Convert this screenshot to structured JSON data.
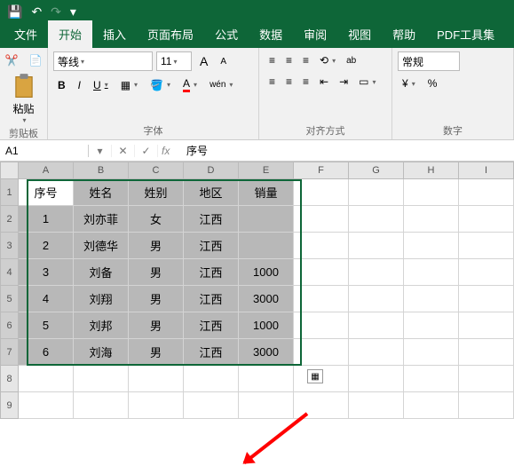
{
  "titlebar": {
    "save": "💾",
    "undo": "↶",
    "redo": "↷",
    "more": "▾"
  },
  "tabs": [
    "文件",
    "开始",
    "插入",
    "页面布局",
    "公式",
    "数据",
    "审阅",
    "视图",
    "帮助",
    "PDF工具集"
  ],
  "activeTab": 1,
  "ribbon": {
    "clip": {
      "paste": "粘贴",
      "label": "剪贴板"
    },
    "font": {
      "name": "等线",
      "size": "11",
      "label": "字体",
      "bold": "B",
      "italic": "I",
      "underline": "U",
      "increase": "A",
      "decrease": "A",
      "phonetic": "wén"
    },
    "align": {
      "label": "对齐方式",
      "wrap": "ab"
    },
    "number": {
      "format": "常规",
      "label": "数字",
      "currency": "¥",
      "percent": "%"
    }
  },
  "namebox": {
    "ref": "A1",
    "formula": "序号"
  },
  "cols": [
    "A",
    "B",
    "C",
    "D",
    "E",
    "F",
    "G",
    "H",
    "I"
  ],
  "rowNums": [
    1,
    2,
    3,
    4,
    5,
    6,
    7,
    8,
    9
  ],
  "chart_data": {
    "type": "table",
    "headers": [
      "序号",
      "姓名",
      "姓别",
      "地区",
      "销量"
    ],
    "rows": [
      [
        "1",
        "刘亦菲",
        "女",
        "江西",
        ""
      ],
      [
        "2",
        "刘德华",
        "男",
        "江西",
        ""
      ],
      [
        "3",
        "刘备",
        "男",
        "江西",
        "1000"
      ],
      [
        "4",
        "刘翔",
        "男",
        "江西",
        "3000"
      ],
      [
        "5",
        "刘邦",
        "男",
        "江西",
        "1000"
      ],
      [
        "6",
        "刘海",
        "男",
        "江西",
        "3000"
      ]
    ]
  }
}
